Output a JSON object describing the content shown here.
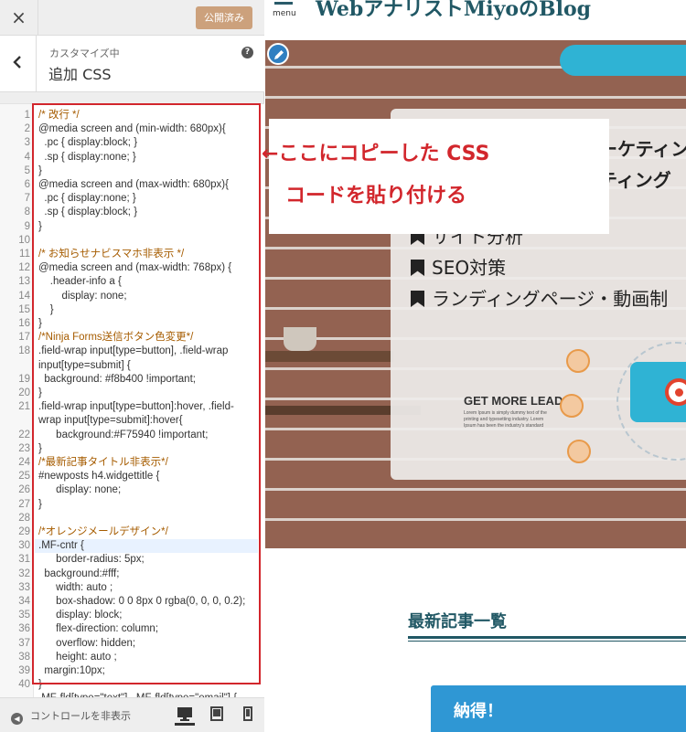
{
  "topbar": {
    "close_icon": "×",
    "publish_label": "公開済み"
  },
  "section": {
    "breadcrumb": "カスタマイズ中",
    "title": "追加 CSS",
    "help": "?"
  },
  "editor": {
    "line_numbers": [
      "1",
      "2",
      "3",
      "4",
      "5",
      "6",
      "7",
      "8",
      "9",
      "10",
      "11",
      "12",
      "13",
      "14",
      "15",
      "16",
      "17",
      "18",
      "19",
      "20",
      "21",
      "22",
      "23",
      "24",
      "25",
      "26",
      "27",
      "28",
      "29",
      "30",
      "31",
      "32",
      "33",
      "34",
      "35",
      "36",
      "37",
      "38",
      "39",
      "40"
    ],
    "lines": [
      "/* 改行 */",
      "@media screen and (min-width: 680px){",
      "  .pc { display:block; }",
      "  .sp { display:none; }",
      "}",
      "@media screen and (max-width: 680px){",
      "  .pc { display:none; }",
      "  .sp { display:block; }",
      "}",
      "",
      "/* お知らせナビスマホ非表示 */",
      "@media screen and (max-width: 768px) {",
      "    .header-info a {",
      "        display: none;",
      "    }",
      "}",
      "/*Ninja Forms送信ボタン色変更*/",
      ".field-wrap input[type=button], .field-wrap",
      "input[type=submit] {",
      "  background: #f8b400 !important;",
      "}",
      ".field-wrap input[type=button]:hover, .field-",
      "wrap input[type=submit]:hover{",
      "      background:#F75940 !important;",
      "}",
      "/*最新記事タイトル非表示*/",
      "#newposts h4.widgettitle {",
      "      display: none;",
      "}",
      "",
      "/*オレンジメールデザイン*/",
      ".MF-cntr {",
      "      border-radius: 5px;",
      "  background:#fff;",
      "      width: auto ;",
      "      box-shadow: 0 0 8px 0 rgba(0, 0, 0, 0.2);",
      "      display: block;",
      "      flex-direction: column;",
      "      overflow: hidden;",
      "      height: auto ;",
      "  margin:10px;",
      "}",
      ".MF-fld[type=\"text\"], .MF-fld[type=\"email\"] {"
    ],
    "active_line": 31
  },
  "bottombar": {
    "hide_controls": "コントロールを非表示",
    "devices": [
      "desktop-icon",
      "tablet-icon",
      "mobile-icon"
    ]
  },
  "preview": {
    "menu_label": "menu",
    "logo": "WebアナリストMiyoのBlog",
    "card_line1": "ーケティン",
    "card_line2": "ティング",
    "features": [
      "サイト分析",
      "SEO対策",
      "ランディングページ・動画制"
    ],
    "leads_title": "GET MORE LEADS",
    "leads_body": "Lorem Ipsum is simply dummy text of the printing and typesetting industry. Lorem Ipsum has been the industry's standard",
    "latest_title": "最新記事一覧",
    "cta_label": "納得！"
  },
  "annotation": {
    "arrow": "←",
    "line1": "ここにコピーした CSS",
    "line2": "コードを貼り付ける"
  },
  "colors": {
    "annotation_red": "#d2262c",
    "publish_button": "#cca17c",
    "brand": "#215865",
    "cta_blue": "#2f97d4"
  }
}
